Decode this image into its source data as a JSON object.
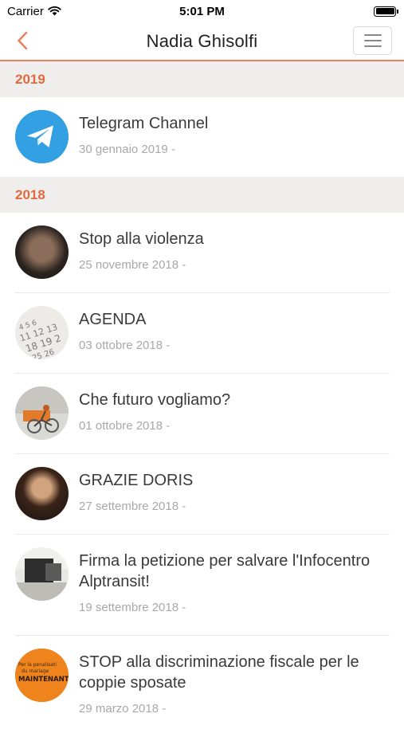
{
  "status_bar": {
    "carrier": "Carrier",
    "time": "5:01 PM",
    "battery_level": 1.0
  },
  "nav": {
    "title": "Nadia Ghisolfi",
    "back_icon": "chevron-left-icon",
    "menu_icon": "hamburger-menu-icon",
    "accent_color": "#e8805a"
  },
  "sections": [
    {
      "year": "2019",
      "items": [
        {
          "title": "Telegram Channel",
          "date": "30 gennaio 2019 -",
          "thumb": "telegram-logo"
        }
      ]
    },
    {
      "year": "2018",
      "items": [
        {
          "title": "Stop alla violenza",
          "date": "25 novembre 2018 -",
          "thumb": "portrait-photo"
        },
        {
          "title": "AGENDA",
          "date": "03 ottobre 2018 -",
          "thumb": "calendar-photo"
        },
        {
          "title": "Che futuro vogliamo?",
          "date": "01 ottobre 2018 -",
          "thumb": "cyclist-photo"
        },
        {
          "title": "GRAZIE DORIS",
          "date": "27 settembre 2018 -",
          "thumb": "portrait-photo"
        },
        {
          "title": "Firma la petizione per salvare l'Infocentro Alptransit!",
          "date": "19 settembre 2018 -",
          "thumb": "building-photo"
        },
        {
          "title": "STOP alla discriminazione fiscale per le coppie sposate",
          "date": "29 marzo 2018 -",
          "thumb": "poster-photo"
        }
      ]
    }
  ],
  "poster_text": {
    "line1": "Per la penalisati",
    "line2": "du mariage",
    "line3": "MAINTENANT"
  }
}
